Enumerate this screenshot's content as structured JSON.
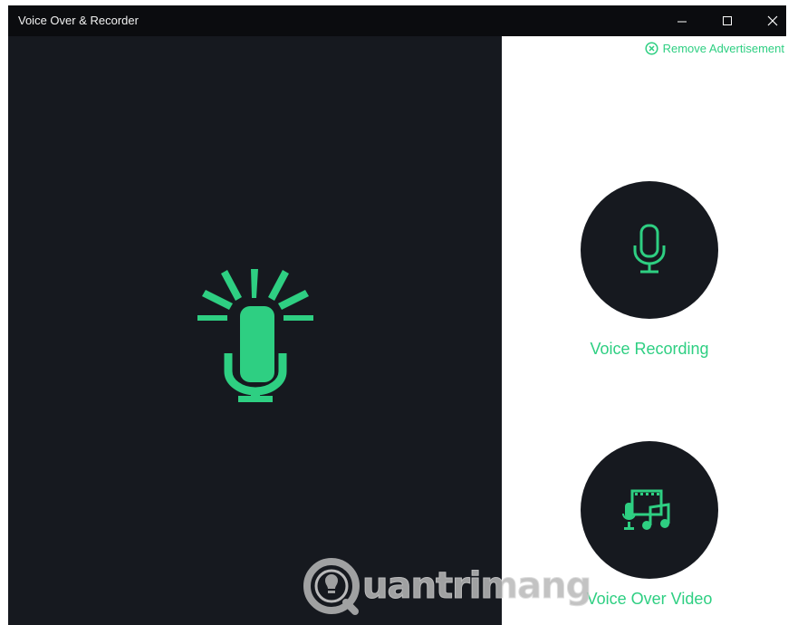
{
  "window": {
    "title": "Voice Over & Recorder",
    "controls": [
      "minimize-icon",
      "maximize-icon",
      "close-icon"
    ]
  },
  "header": {
    "remove_ad_label": "Remove Advertisement",
    "remove_ad_icon": "circle-x-icon"
  },
  "options": [
    {
      "label": "Voice Recording",
      "icon": "microphone-icon"
    },
    {
      "label": "Voice Over Video",
      "icon": "film-music-icon"
    }
  ],
  "hero_icon": "microphone-broadcast-icon",
  "watermark": {
    "text": "uantrimang",
    "logo": "quantrimang-logo"
  },
  "colors": {
    "accent": "#2ecf82",
    "dark_panel": "#16191f",
    "titlebar": "#0b0c0f",
    "light_panel": "#ffffff"
  }
}
